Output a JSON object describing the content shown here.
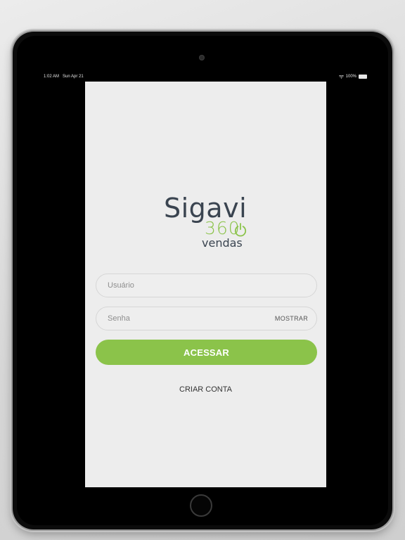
{
  "status_bar": {
    "time": "1:02 AM",
    "date": "Sun Apr 21",
    "battery": "100%",
    "wifi_icon": "wifi-icon",
    "battery_icon": "battery-icon"
  },
  "logo": {
    "brand": "Sigavi",
    "number": "360",
    "subtitle": "vendas",
    "power_icon": "power-icon",
    "brand_color": "#3a4450",
    "accent_color": "#8bc34a"
  },
  "form": {
    "username_placeholder": "Usuário",
    "username_value": "",
    "password_placeholder": "Senha",
    "password_value": "",
    "show_label": "MOSTRAR",
    "submit_label": "ACESSAR",
    "create_account_label": "CRIAR CONTA"
  },
  "colors": {
    "button_green": "#8bc34a",
    "screen_background": "#ededed",
    "device_frame": "#0b0b0b"
  }
}
